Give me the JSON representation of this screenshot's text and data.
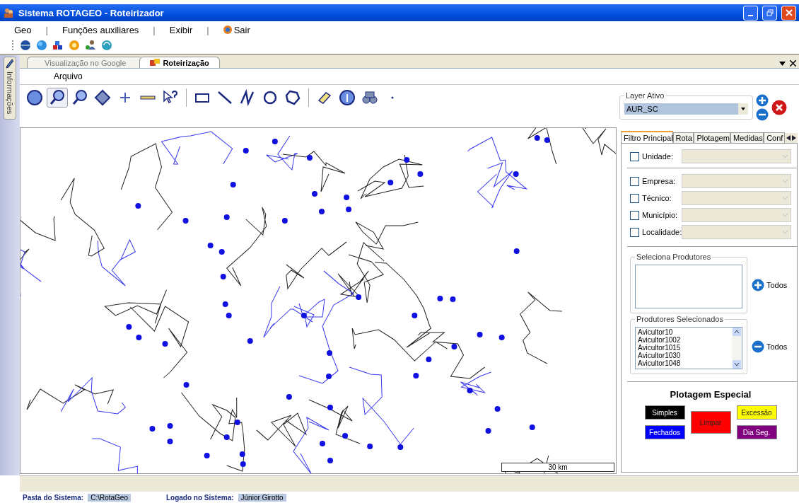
{
  "window": {
    "title": "Sistema ROTAGEO - Roteirizador"
  },
  "menu": [
    {
      "kind": "item",
      "label": "Geo"
    },
    {
      "kind": "separator",
      "label": "|"
    },
    {
      "kind": "item",
      "label": "Funções auxiliares"
    },
    {
      "kind": "separator",
      "label": "|"
    },
    {
      "kind": "item",
      "label": "Exibir"
    },
    {
      "kind": "separator",
      "label": "|"
    },
    {
      "kind": "icon-item",
      "label": "Sair"
    }
  ],
  "quick_icons": [
    {
      "kind": "globe"
    },
    {
      "kind": "earth"
    },
    {
      "kind": "blocks"
    },
    {
      "kind": "sun"
    },
    {
      "kind": "person"
    },
    {
      "kind": "refresh"
    }
  ],
  "side_tab": {
    "label": "Informações"
  },
  "doc_tabs": [
    {
      "label": "Visualização no Google",
      "selected": false
    },
    {
      "label": "Roteirização",
      "selected": true
    }
  ],
  "doc_menu": [
    "Arquivo"
  ],
  "tools": [
    {
      "kind": "sphere",
      "selected": false
    },
    {
      "kind": "zoom-in",
      "selected": true
    },
    {
      "kind": "zoom-out",
      "selected": false
    },
    {
      "kind": "pan",
      "selected": false
    },
    {
      "kind": "plus",
      "selected": false
    },
    {
      "kind": "ruler",
      "selected": false
    },
    {
      "kind": "query",
      "selected": false
    },
    {
      "kind": "sep"
    },
    {
      "kind": "rect",
      "selected": false
    },
    {
      "kind": "line",
      "selected": false
    },
    {
      "kind": "polyline",
      "selected": false
    },
    {
      "kind": "circle",
      "selected": false
    },
    {
      "kind": "polygon",
      "selected": false
    },
    {
      "kind": "sep"
    },
    {
      "kind": "eraser",
      "selected": false
    },
    {
      "kind": "info",
      "selected": false
    },
    {
      "kind": "binoculars",
      "selected": false
    },
    {
      "kind": "dot",
      "selected": false
    }
  ],
  "map": {
    "scale": "30 km"
  },
  "layer": {
    "legend": "Layer Ativo",
    "value": "AUR_SC"
  },
  "panel_tabs": [
    {
      "label": "Filtro Principal",
      "selected": true
    },
    {
      "label": "Rota",
      "selected": false
    },
    {
      "label": "Plotagem",
      "selected": false
    },
    {
      "label": "Medidas",
      "selected": false
    },
    {
      "label": "Conf",
      "selected": false
    }
  ],
  "filters": [
    {
      "label": "Unidade:",
      "checked": false,
      "disabled": true
    },
    {
      "label": "Empresa:",
      "checked": false,
      "disabled": true
    },
    {
      "label": "Técnico:",
      "checked": false,
      "disabled": true
    },
    {
      "label": "Município:",
      "checked": false,
      "disabled": true
    },
    {
      "label": "Localidade:",
      "checked": false,
      "disabled": true
    }
  ],
  "select_producers": {
    "legend": "Seleciona Produtores",
    "button": "Todos"
  },
  "selected_producers": {
    "legend": "Produtores Selecionados",
    "button": "Todos",
    "items": [
      "Avicultor10",
      "Avicultor1002",
      "Avicultor1015",
      "Avicultor1030",
      "Avicultor1048"
    ]
  },
  "special": {
    "title": "Plotagem Especial",
    "buttons": [
      {
        "label": "Simples",
        "color": "#000000"
      },
      {
        "label": "Limpar",
        "color": "#ff0000"
      },
      {
        "label": "Excessão",
        "color": "#ffff00"
      },
      {
        "label": "Fechados",
        "color": "#0000ff"
      },
      {
        "label": "Dia Seg.",
        "color": "#800080"
      }
    ]
  },
  "status": [
    {
      "label": "Pasta do Sistema:",
      "value": "C:\\RotaGeo"
    },
    {
      "label": "Logado no Sistema:",
      "value": "Júnior Girotto"
    }
  ]
}
